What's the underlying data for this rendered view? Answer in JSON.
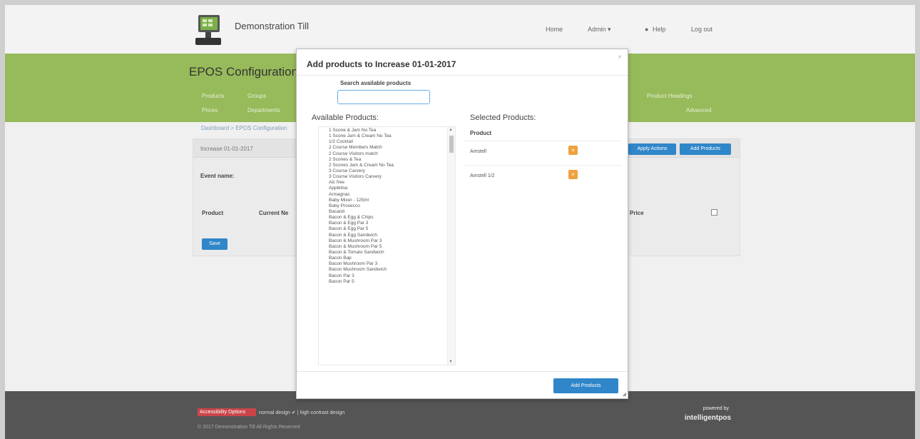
{
  "header": {
    "app_title": "Demonstration Till",
    "nav": [
      "Home",
      "Admin ▾",
      "Help",
      "Log out"
    ]
  },
  "band": {
    "title": "EPOS Configuration",
    "links_row1_left": [
      "Products",
      "Groups"
    ],
    "links_row1_right": "Product Headings",
    "links_row2_left": [
      "Prices",
      "Departments"
    ],
    "links_row2_right": "Advanced"
  },
  "breadcrumb": "Dashboard > EPOS Configuration",
  "panel": {
    "head": "Increase 01-01-2017",
    "event_name_label": "Event name:",
    "col_product": "Product",
    "col_current": "Current Ne",
    "col_price": "Price",
    "save_label": "Save",
    "btn_apply": "Apply Actions",
    "btn_add_products": "Add Products"
  },
  "footer": {
    "badge": "Accessibility Options",
    "design_links": "normal design ✔ | high contrast design",
    "copyright": "© 2017 Demonstration Till All Rights Reserved",
    "powered_by": "powered by",
    "brand": "intelligentpos"
  },
  "modal": {
    "title": "Add products to Increase 01-01-2017",
    "search_label": "Search available products",
    "search_value": "",
    "available_title": "Available Products:",
    "selected_title": "Selected Products:",
    "selected_col_header": "Product",
    "available": [
      "1 Scone & Jam No Tea",
      "1 Scone Jam & Cream No Tea",
      "1/2 Cocktail",
      "2 Course Members Match",
      "2 Course Visitors match",
      "2 Scones & Tea",
      "2 Scones Jam & Cream No Tea",
      "3 Course Carvery",
      "3 Course Visitors Carvery",
      "Alc free",
      "Appletise",
      "Armagnac",
      "Baby Mixer - 125ml",
      "Baby Prosecco",
      "Bacardi",
      "Bacon & Egg & Chips",
      "Bacon & Egg Par 3",
      "Bacon & Egg Par 5",
      "Bacon & Egg Sandwich",
      "Bacon & Mushroom Par 3",
      "Bacon & Mushroom Par 5",
      "Bacon & Tomato Sandwich",
      "Bacon Bap",
      "Bacon Mushroom Par 3",
      "Bacon Mushroom Sandwich",
      "Bacon Par 3",
      "Bacon Par 5"
    ],
    "selected": [
      {
        "name": "Amstell"
      },
      {
        "name": "Amstell 1/2"
      }
    ],
    "add_button": "Add Products"
  }
}
